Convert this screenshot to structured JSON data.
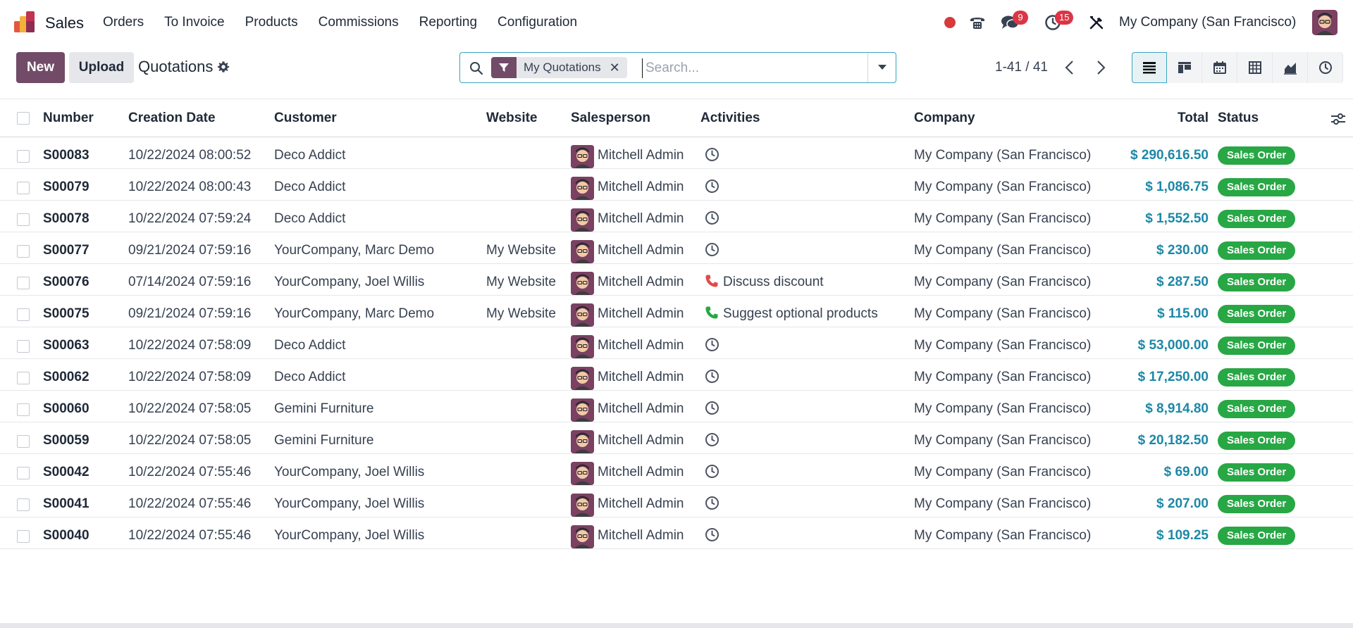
{
  "app": {
    "name": "Sales",
    "menu": [
      "Orders",
      "To Invoice",
      "Products",
      "Commissions",
      "Reporting",
      "Configuration"
    ],
    "chat_badge": "9",
    "activity_badge": "15",
    "company": "My Company (San Francisco)"
  },
  "control": {
    "new_label": "New",
    "upload_label": "Upload",
    "breadcrumb": "Quotations",
    "facet_label": "My Quotations",
    "search_placeholder": "Search...",
    "pager": "1-41 / 41"
  },
  "colors": {
    "brand": "#714b67",
    "accent": "#1c88a6",
    "status_green": "#28a745",
    "badge_red": "#dc3545"
  },
  "table": {
    "headers": {
      "number": "Number",
      "creation_date": "Creation Date",
      "customer": "Customer",
      "website": "Website",
      "salesperson": "Salesperson",
      "activities": "Activities",
      "company": "Company",
      "total": "Total",
      "status": "Status"
    },
    "rows": [
      {
        "number": "S00083",
        "date": "10/22/2024 08:00:52",
        "customer": "Deco Addict",
        "website": "",
        "salesperson": "Mitchell Admin",
        "activity": "clock-icon",
        "activity_text": "",
        "company": "My Company (San Francisco)",
        "total": "$ 290,616.50",
        "status": "Sales Order"
      },
      {
        "number": "S00079",
        "date": "10/22/2024 08:00:43",
        "customer": "Deco Addict",
        "website": "",
        "salesperson": "Mitchell Admin",
        "activity": "clock-icon",
        "activity_text": "",
        "company": "My Company (San Francisco)",
        "total": "$ 1,086.75",
        "status": "Sales Order"
      },
      {
        "number": "S00078",
        "date": "10/22/2024 07:59:24",
        "customer": "Deco Addict",
        "website": "",
        "salesperson": "Mitchell Admin",
        "activity": "clock-icon",
        "activity_text": "",
        "company": "My Company (San Francisco)",
        "total": "$ 1,552.50",
        "status": "Sales Order"
      },
      {
        "number": "S00077",
        "date": "09/21/2024 07:59:16",
        "customer": "YourCompany, Marc Demo",
        "website": "My Website",
        "salesperson": "Mitchell Admin",
        "activity": "clock-icon",
        "activity_text": "",
        "company": "My Company (San Francisco)",
        "total": "$ 230.00",
        "status": "Sales Order"
      },
      {
        "number": "S00076",
        "date": "07/14/2024 07:59:16",
        "customer": "YourCompany, Joel Willis",
        "website": "My Website",
        "salesperson": "Mitchell Admin",
        "activity": "phone-red-icon",
        "activity_text": "Discuss discount",
        "company": "My Company (San Francisco)",
        "total": "$ 287.50",
        "status": "Sales Order"
      },
      {
        "number": "S00075",
        "date": "09/21/2024 07:59:16",
        "customer": "YourCompany, Marc Demo",
        "website": "My Website",
        "salesperson": "Mitchell Admin",
        "activity": "phone-green-icon",
        "activity_text": "Suggest optional products",
        "company": "My Company (San Francisco)",
        "total": "$ 115.00",
        "status": "Sales Order"
      },
      {
        "number": "S00063",
        "date": "10/22/2024 07:58:09",
        "customer": "Deco Addict",
        "website": "",
        "salesperson": "Mitchell Admin",
        "activity": "clock-icon",
        "activity_text": "",
        "company": "My Company (San Francisco)",
        "total": "$ 53,000.00",
        "status": "Sales Order"
      },
      {
        "number": "S00062",
        "date": "10/22/2024 07:58:09",
        "customer": "Deco Addict",
        "website": "",
        "salesperson": "Mitchell Admin",
        "activity": "clock-icon",
        "activity_text": "",
        "company": "My Company (San Francisco)",
        "total": "$ 17,250.00",
        "status": "Sales Order"
      },
      {
        "number": "S00060",
        "date": "10/22/2024 07:58:05",
        "customer": "Gemini Furniture",
        "website": "",
        "salesperson": "Mitchell Admin",
        "activity": "clock-icon",
        "activity_text": "",
        "company": "My Company (San Francisco)",
        "total": "$ 8,914.80",
        "status": "Sales Order"
      },
      {
        "number": "S00059",
        "date": "10/22/2024 07:58:05",
        "customer": "Gemini Furniture",
        "website": "",
        "salesperson": "Mitchell Admin",
        "activity": "clock-icon",
        "activity_text": "",
        "company": "My Company (San Francisco)",
        "total": "$ 20,182.50",
        "status": "Sales Order"
      },
      {
        "number": "S00042",
        "date": "10/22/2024 07:55:46",
        "customer": "YourCompany, Joel Willis",
        "website": "",
        "salesperson": "Mitchell Admin",
        "activity": "clock-icon",
        "activity_text": "",
        "company": "My Company (San Francisco)",
        "total": "$ 69.00",
        "status": "Sales Order"
      },
      {
        "number": "S00041",
        "date": "10/22/2024 07:55:46",
        "customer": "YourCompany, Joel Willis",
        "website": "",
        "salesperson": "Mitchell Admin",
        "activity": "clock-icon",
        "activity_text": "",
        "company": "My Company (San Francisco)",
        "total": "$ 207.00",
        "status": "Sales Order"
      },
      {
        "number": "S00040",
        "date": "10/22/2024 07:55:46",
        "customer": "YourCompany, Joel Willis",
        "website": "",
        "salesperson": "Mitchell Admin",
        "activity": "clock-icon",
        "activity_text": "",
        "company": "My Company (San Francisco)",
        "total": "$ 109.25",
        "status": "Sales Order"
      }
    ]
  }
}
